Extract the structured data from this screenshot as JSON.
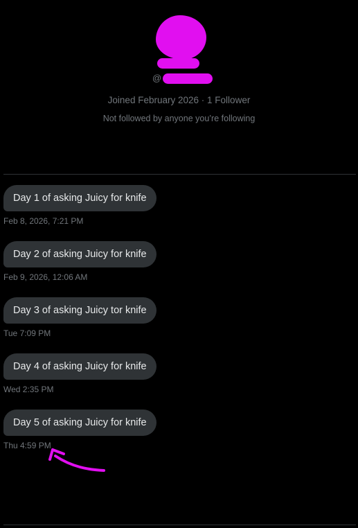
{
  "profile": {
    "avatar_state": "redacted",
    "name_state": "redacted",
    "handle_prefix": "@",
    "joined": "Joined February 2026",
    "separator": "·",
    "followers": "1 Follower",
    "followers_note": "Not followed by anyone you’re following",
    "redaction_color": "#e10ff0"
  },
  "messages": [
    {
      "text": "Day 1 of asking Juicy for knife",
      "timestamp": "Feb 8, 2026, 7:21 PM"
    },
    {
      "text": "Day 2 of asking Juicy for knife",
      "timestamp": "Feb 9, 2026, 12:06 AM"
    },
    {
      "text": "Day 3 of asking Juicy tor knife",
      "timestamp": "Tue 7:09 PM"
    },
    {
      "text": "Day 4 of asking Juicy for knife",
      "timestamp": "Wed 2:35 PM"
    },
    {
      "text": "Day 5 of asking Juicy for knife",
      "timestamp": "Thu 4:59 PM"
    }
  ],
  "annotation": {
    "type": "hand-drawn-arrow",
    "color": "#e10ff0",
    "points_to": "Thu 4:59 PM"
  },
  "theme": {
    "background": "#000000",
    "bubble": "#2f3336",
    "text": "#e7e9ea",
    "muted_text": "#71767b",
    "divider": "#2f3336"
  }
}
